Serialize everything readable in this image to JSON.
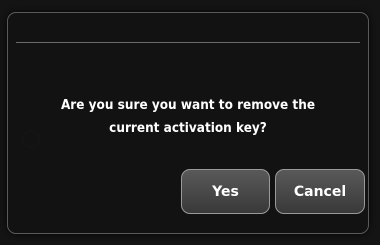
{
  "dialog": {
    "message": "Are you sure you want to remove the current activation key?",
    "yes_label": "Yes",
    "cancel_label": "Cancel"
  },
  "colors": {
    "dialog_background": "#121212",
    "button_gradient_top": "#595959",
    "button_gradient_bottom": "#393939",
    "text": "#ffffff"
  }
}
